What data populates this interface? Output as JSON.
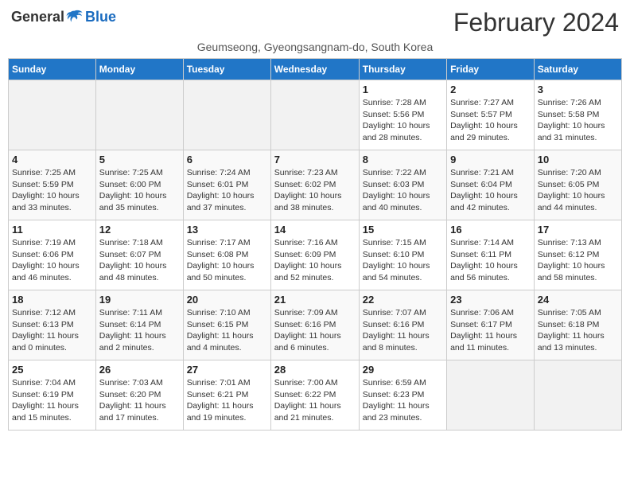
{
  "header": {
    "logo": {
      "general": "General",
      "blue": "Blue"
    },
    "title": "February 2024",
    "location": "Geumseong, Gyeongsangnam-do, South Korea"
  },
  "days_of_week": [
    "Sunday",
    "Monday",
    "Tuesday",
    "Wednesday",
    "Thursday",
    "Friday",
    "Saturday"
  ],
  "weeks": [
    [
      {
        "day": "",
        "info": ""
      },
      {
        "day": "",
        "info": ""
      },
      {
        "day": "",
        "info": ""
      },
      {
        "day": "",
        "info": ""
      },
      {
        "day": "1",
        "info": "Sunrise: 7:28 AM\nSunset: 5:56 PM\nDaylight: 10 hours and 28 minutes."
      },
      {
        "day": "2",
        "info": "Sunrise: 7:27 AM\nSunset: 5:57 PM\nDaylight: 10 hours and 29 minutes."
      },
      {
        "day": "3",
        "info": "Sunrise: 7:26 AM\nSunset: 5:58 PM\nDaylight: 10 hours and 31 minutes."
      }
    ],
    [
      {
        "day": "4",
        "info": "Sunrise: 7:25 AM\nSunset: 5:59 PM\nDaylight: 10 hours and 33 minutes."
      },
      {
        "day": "5",
        "info": "Sunrise: 7:25 AM\nSunset: 6:00 PM\nDaylight: 10 hours and 35 minutes."
      },
      {
        "day": "6",
        "info": "Sunrise: 7:24 AM\nSunset: 6:01 PM\nDaylight: 10 hours and 37 minutes."
      },
      {
        "day": "7",
        "info": "Sunrise: 7:23 AM\nSunset: 6:02 PM\nDaylight: 10 hours and 38 minutes."
      },
      {
        "day": "8",
        "info": "Sunrise: 7:22 AM\nSunset: 6:03 PM\nDaylight: 10 hours and 40 minutes."
      },
      {
        "day": "9",
        "info": "Sunrise: 7:21 AM\nSunset: 6:04 PM\nDaylight: 10 hours and 42 minutes."
      },
      {
        "day": "10",
        "info": "Sunrise: 7:20 AM\nSunset: 6:05 PM\nDaylight: 10 hours and 44 minutes."
      }
    ],
    [
      {
        "day": "11",
        "info": "Sunrise: 7:19 AM\nSunset: 6:06 PM\nDaylight: 10 hours and 46 minutes."
      },
      {
        "day": "12",
        "info": "Sunrise: 7:18 AM\nSunset: 6:07 PM\nDaylight: 10 hours and 48 minutes."
      },
      {
        "day": "13",
        "info": "Sunrise: 7:17 AM\nSunset: 6:08 PM\nDaylight: 10 hours and 50 minutes."
      },
      {
        "day": "14",
        "info": "Sunrise: 7:16 AM\nSunset: 6:09 PM\nDaylight: 10 hours and 52 minutes."
      },
      {
        "day": "15",
        "info": "Sunrise: 7:15 AM\nSunset: 6:10 PM\nDaylight: 10 hours and 54 minutes."
      },
      {
        "day": "16",
        "info": "Sunrise: 7:14 AM\nSunset: 6:11 PM\nDaylight: 10 hours and 56 minutes."
      },
      {
        "day": "17",
        "info": "Sunrise: 7:13 AM\nSunset: 6:12 PM\nDaylight: 10 hours and 58 minutes."
      }
    ],
    [
      {
        "day": "18",
        "info": "Sunrise: 7:12 AM\nSunset: 6:13 PM\nDaylight: 11 hours and 0 minutes."
      },
      {
        "day": "19",
        "info": "Sunrise: 7:11 AM\nSunset: 6:14 PM\nDaylight: 11 hours and 2 minutes."
      },
      {
        "day": "20",
        "info": "Sunrise: 7:10 AM\nSunset: 6:15 PM\nDaylight: 11 hours and 4 minutes."
      },
      {
        "day": "21",
        "info": "Sunrise: 7:09 AM\nSunset: 6:16 PM\nDaylight: 11 hours and 6 minutes."
      },
      {
        "day": "22",
        "info": "Sunrise: 7:07 AM\nSunset: 6:16 PM\nDaylight: 11 hours and 8 minutes."
      },
      {
        "day": "23",
        "info": "Sunrise: 7:06 AM\nSunset: 6:17 PM\nDaylight: 11 hours and 11 minutes."
      },
      {
        "day": "24",
        "info": "Sunrise: 7:05 AM\nSunset: 6:18 PM\nDaylight: 11 hours and 13 minutes."
      }
    ],
    [
      {
        "day": "25",
        "info": "Sunrise: 7:04 AM\nSunset: 6:19 PM\nDaylight: 11 hours and 15 minutes."
      },
      {
        "day": "26",
        "info": "Sunrise: 7:03 AM\nSunset: 6:20 PM\nDaylight: 11 hours and 17 minutes."
      },
      {
        "day": "27",
        "info": "Sunrise: 7:01 AM\nSunset: 6:21 PM\nDaylight: 11 hours and 19 minutes."
      },
      {
        "day": "28",
        "info": "Sunrise: 7:00 AM\nSunset: 6:22 PM\nDaylight: 11 hours and 21 minutes."
      },
      {
        "day": "29",
        "info": "Sunrise: 6:59 AM\nSunset: 6:23 PM\nDaylight: 11 hours and 23 minutes."
      },
      {
        "day": "",
        "info": ""
      },
      {
        "day": "",
        "info": ""
      }
    ]
  ]
}
